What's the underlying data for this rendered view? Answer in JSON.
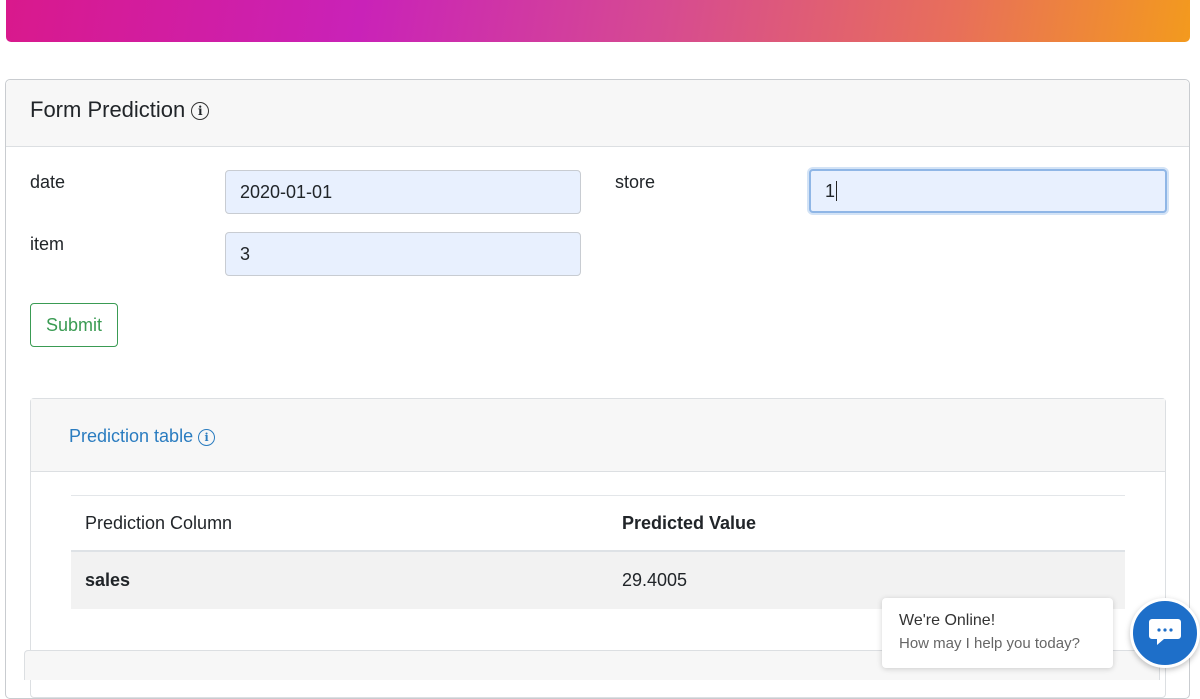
{
  "banner": {
    "gradient_colors": [
      "#d9198c",
      "#c922b8",
      "#e86f5a",
      "#f39a1e"
    ]
  },
  "form": {
    "title": "Form Prediction",
    "fields": {
      "date": {
        "label": "date",
        "value": "2020-01-01"
      },
      "store": {
        "label": "store",
        "value": "1"
      },
      "item": {
        "label": "item",
        "value": "3"
      }
    },
    "submit_label": "Submit"
  },
  "prediction": {
    "title": "Prediction table",
    "columns": [
      "Prediction Column",
      "Predicted Value"
    ],
    "rows": [
      {
        "column": "sales",
        "value": "29.4005"
      }
    ]
  },
  "chat": {
    "line1": "We're Online!",
    "line2": "How may I help you today?",
    "accent": "#1e6fc9"
  },
  "colors": {
    "success": "#3a9b53",
    "link": "#2a7cc0",
    "input_bg": "#e8f0fe"
  }
}
